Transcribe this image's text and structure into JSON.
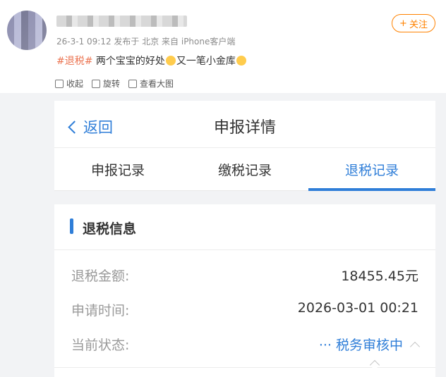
{
  "post": {
    "meta": "26-3-1 09:12 发布于 北京 来自 iPhone客户端",
    "follow_label": "关注",
    "tag": "#退税#",
    "text_before_emoji": " 两个宝宝的好处",
    "text_after_emoji": "又一笔小金库"
  },
  "toolbar": {
    "collect_label": "收起",
    "rotate_label": "旋转",
    "view_label": "查看大图"
  },
  "screen": {
    "back_label": "返回",
    "title": "申报详情",
    "tabs": [
      {
        "label": "申报记录"
      },
      {
        "label": "缴税记录"
      },
      {
        "label": "退税记录",
        "active": true
      }
    ],
    "section_title": "退税信息",
    "rows": [
      {
        "key": "退税金额:",
        "value": "18455.45元"
      },
      {
        "key": "申请时间:",
        "value": "2026-03-01 00:21"
      },
      {
        "key": "当前状态:",
        "value": "··· 税务审核中"
      }
    ]
  },
  "colors": {
    "accent": "#2f7ed8",
    "follow": "#ff8200",
    "tag": "#eb7350"
  }
}
